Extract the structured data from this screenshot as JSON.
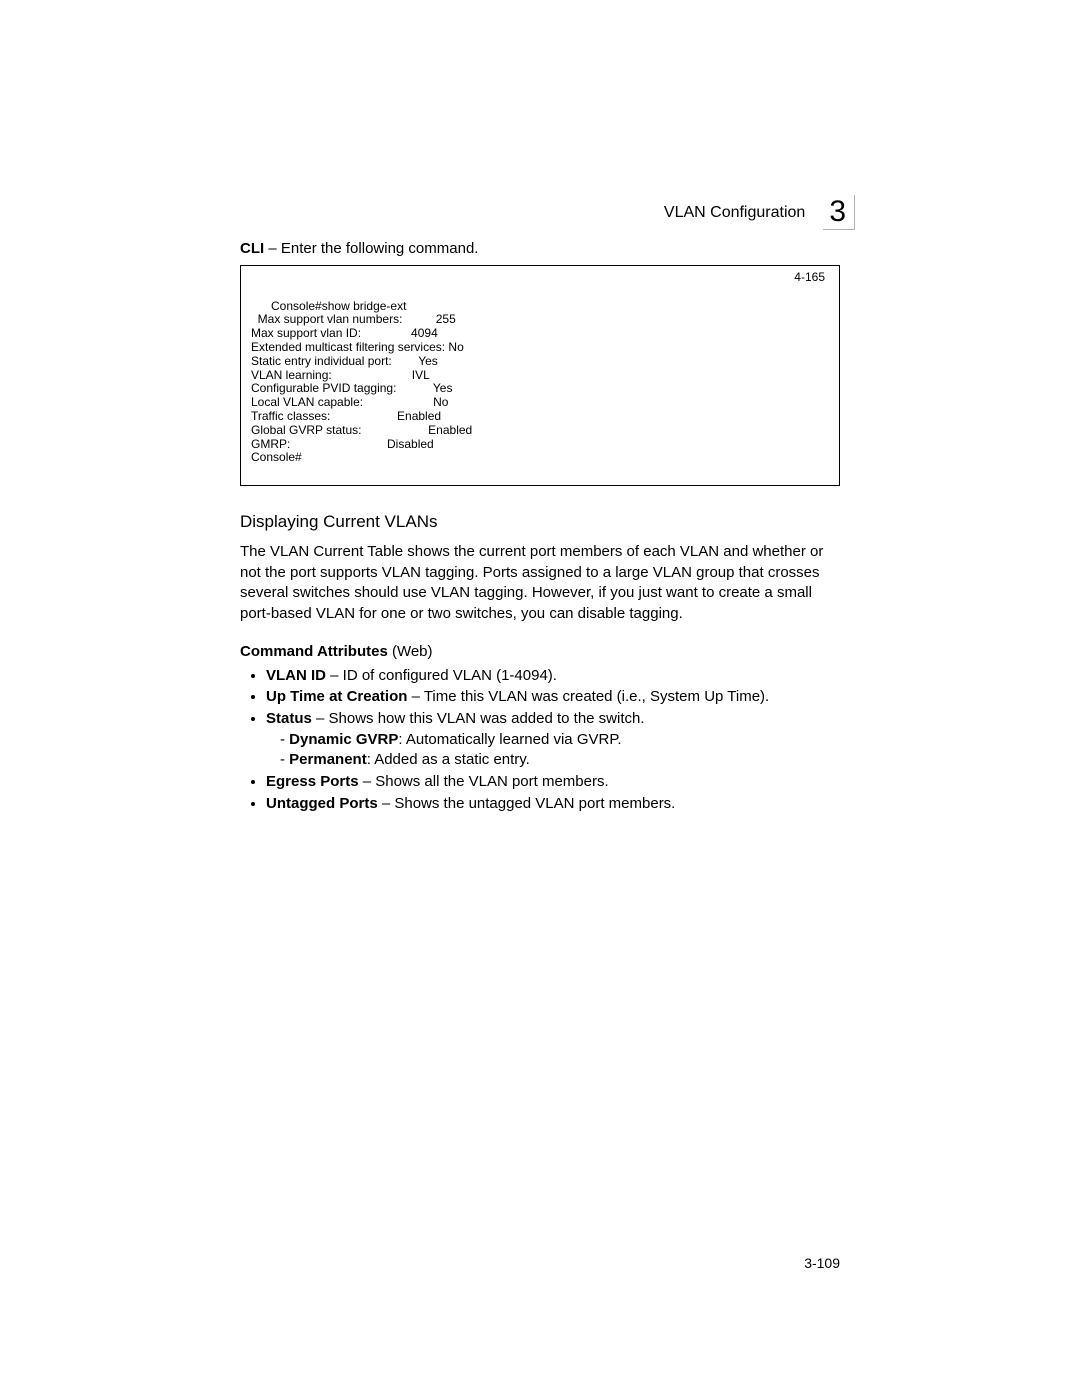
{
  "header": {
    "title": "VLAN Configuration",
    "chapter": "3"
  },
  "cli": {
    "intro_bold": "CLI",
    "intro_rest": " – Enter the following command.",
    "ref": "4-165",
    "output": "Console#show bridge-ext\n  Max support vlan numbers:          255\nMax support vlan ID:               4094\nExtended multicast filtering services: No\nStatic entry individual port:        Yes\nVLAN learning:                        IVL\nConfigurable PVID tagging:           Yes\nLocal VLAN capable:                     No\nTraffic classes:                    Enabled\nGlobal GVRP status:                    Enabled\nGMRP:                             Disabled\nConsole#"
  },
  "section": {
    "heading": "Displaying Current VLANs",
    "body": "The VLAN Current Table shows the current port members of each VLAN and whether or not the port supports VLAN tagging. Ports assigned to a large VLAN group that crosses several switches should use VLAN tagging. However, if you just want to create a small port-based VLAN for one or two switches, you can disable tagging."
  },
  "attributes": {
    "heading_bold": "Command Attributes",
    "heading_rest": " (Web)",
    "items": [
      {
        "bold": "VLAN ID",
        "rest": " – ID of configured VLAN (1-4094)."
      },
      {
        "bold": "Up Time at Creation",
        "rest": " – Time this VLAN was created (i.e., System Up Time)."
      },
      {
        "bold": "Status",
        "rest": " – Shows how this VLAN was added to the switch.",
        "subs": [
          {
            "bold": "Dynamic GVRP",
            "rest": ": Automatically learned via GVRP."
          },
          {
            "bold": "Permanent",
            "rest": ": Added as a static entry."
          }
        ]
      },
      {
        "bold": "Egress Ports",
        "rest": " – Shows all the VLAN port members."
      },
      {
        "bold": "Untagged Ports",
        "rest": " – Shows the untagged VLAN port members."
      }
    ]
  },
  "page_number": "3-109"
}
